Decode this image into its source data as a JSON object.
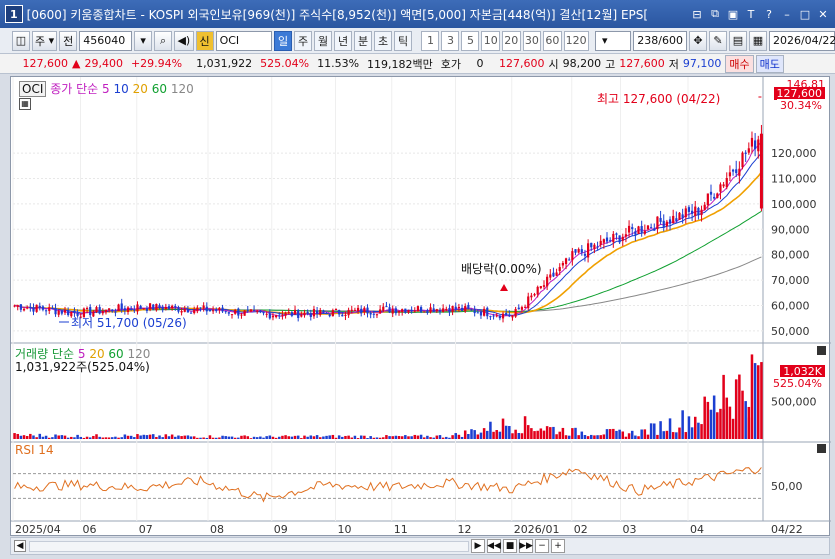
{
  "window": {
    "app_number": "1",
    "title": "[0600] 키움종합차트 - KOSPI 외국인보유[969(천)] 주식수[8,952(천)] 액면[5,000] 자본금[448(억)] 결산[12월] EPS["
  },
  "toolbar": {
    "period_selector": "주",
    "prev_label": "전",
    "stock_code": "456040",
    "credit_badge": "신",
    "stock_name": "OCI",
    "period_tabs": [
      "일",
      "주",
      "월",
      "년",
      "분",
      "초",
      "틱"
    ],
    "active_period": "일",
    "interval_tabs": [
      "1",
      "3",
      "5",
      "10",
      "20",
      "30",
      "60",
      "120"
    ],
    "count_value": "238",
    "count_total": "/600",
    "date_value": "2026/04/22"
  },
  "quote": {
    "price": "127,600",
    "change": "29,400",
    "change_pct": "+29.94%",
    "volume": "1,031,922",
    "volume_ratio": "525.04%",
    "turnover": "11.53%",
    "amount": "119,182백만",
    "bid_label": "호가",
    "bid_value": "0",
    "quote_price": "127,600",
    "open_label": "시",
    "open_value": "98,200",
    "high_label": "고",
    "high_value": "127,600",
    "low_label": "저",
    "low_value": "97,100",
    "buy_label": "매수",
    "sell_label": "매도"
  },
  "price_panel": {
    "stock_tag": "OCI",
    "ma_label": "종가 단순",
    "ma_periods": [
      "5",
      "10",
      "20",
      "60",
      "120"
    ],
    "ma_colors": [
      "#c020c0",
      "#1b3fd1",
      "#f0a000",
      "#10a030",
      "#888888"
    ],
    "top_value": "146,81",
    "last_badge": "127,600",
    "last_badge_pct": "30.34%",
    "max_annotation": "최고 127,600 (04/22)",
    "min_annotation": "최저 51,700 (05/26)",
    "dividend_annotation": "배당락(0.00%)",
    "y_ticks": [
      "120,000",
      "110,000",
      "100,000",
      "90,000",
      "80,000",
      "70,000",
      "60,000",
      "50,000"
    ]
  },
  "volume_panel": {
    "title": "거래량 단순",
    "ma_periods": [
      "5",
      "20",
      "60",
      "120"
    ],
    "current": "1,031,922주(525.04%)",
    "badge": "1,032K",
    "badge_pct": "525.04%",
    "y_tick": "500,000"
  },
  "rsi_panel": {
    "title": "RSI 14",
    "y_tick": "50,00"
  },
  "x_axis": {
    "ticks": [
      "2025/04",
      "06",
      "07",
      "08",
      "09",
      "10",
      "11",
      "12",
      "2026/01",
      "02",
      "03",
      "04"
    ],
    "right_label": "04/22"
  },
  "chart_data": [
    {
      "type": "candlestick",
      "title": "",
      "xlabel": "",
      "ylabel": "",
      "ylim": [
        46810,
        146810
      ],
      "x": [
        "2025/04",
        "06",
        "07",
        "08",
        "09",
        "10",
        "11",
        "12",
        "2026/01",
        "02",
        "03",
        "04",
        "04/22"
      ],
      "series": [
        {
          "name": "종가",
          "values": [
            60000,
            57000,
            59500,
            58500,
            56500,
            57000,
            58500,
            59000,
            56000,
            80000,
            90000,
            97500,
            127600
          ]
        }
      ],
      "annotations": {
        "max": 127600,
        "min": 51700
      }
    },
    {
      "type": "bar",
      "title": "",
      "x": [
        "2025/04",
        "06",
        "07",
        "08",
        "09",
        "10",
        "11",
        "12",
        "2026/01",
        "02",
        "03",
        "04",
        "04/22"
      ],
      "values": [
        60000,
        45000,
        50000,
        40000,
        35000,
        42000,
        38000,
        45000,
        250000,
        110000,
        90000,
        370000,
        1031922
      ],
      "ylim": [
        0,
        1100000
      ]
    },
    {
      "type": "line",
      "title": "",
      "x": [
        "2025/04",
        "06",
        "07",
        "08",
        "09",
        "10",
        "11",
        "12",
        "2026/01",
        "02",
        "03",
        "04",
        "04/22"
      ],
      "values": [
        48,
        52,
        47,
        58,
        30,
        52,
        48,
        55,
        45,
        78,
        42,
        60,
        80
      ],
      "ylim": [
        0,
        100
      ]
    }
  ]
}
